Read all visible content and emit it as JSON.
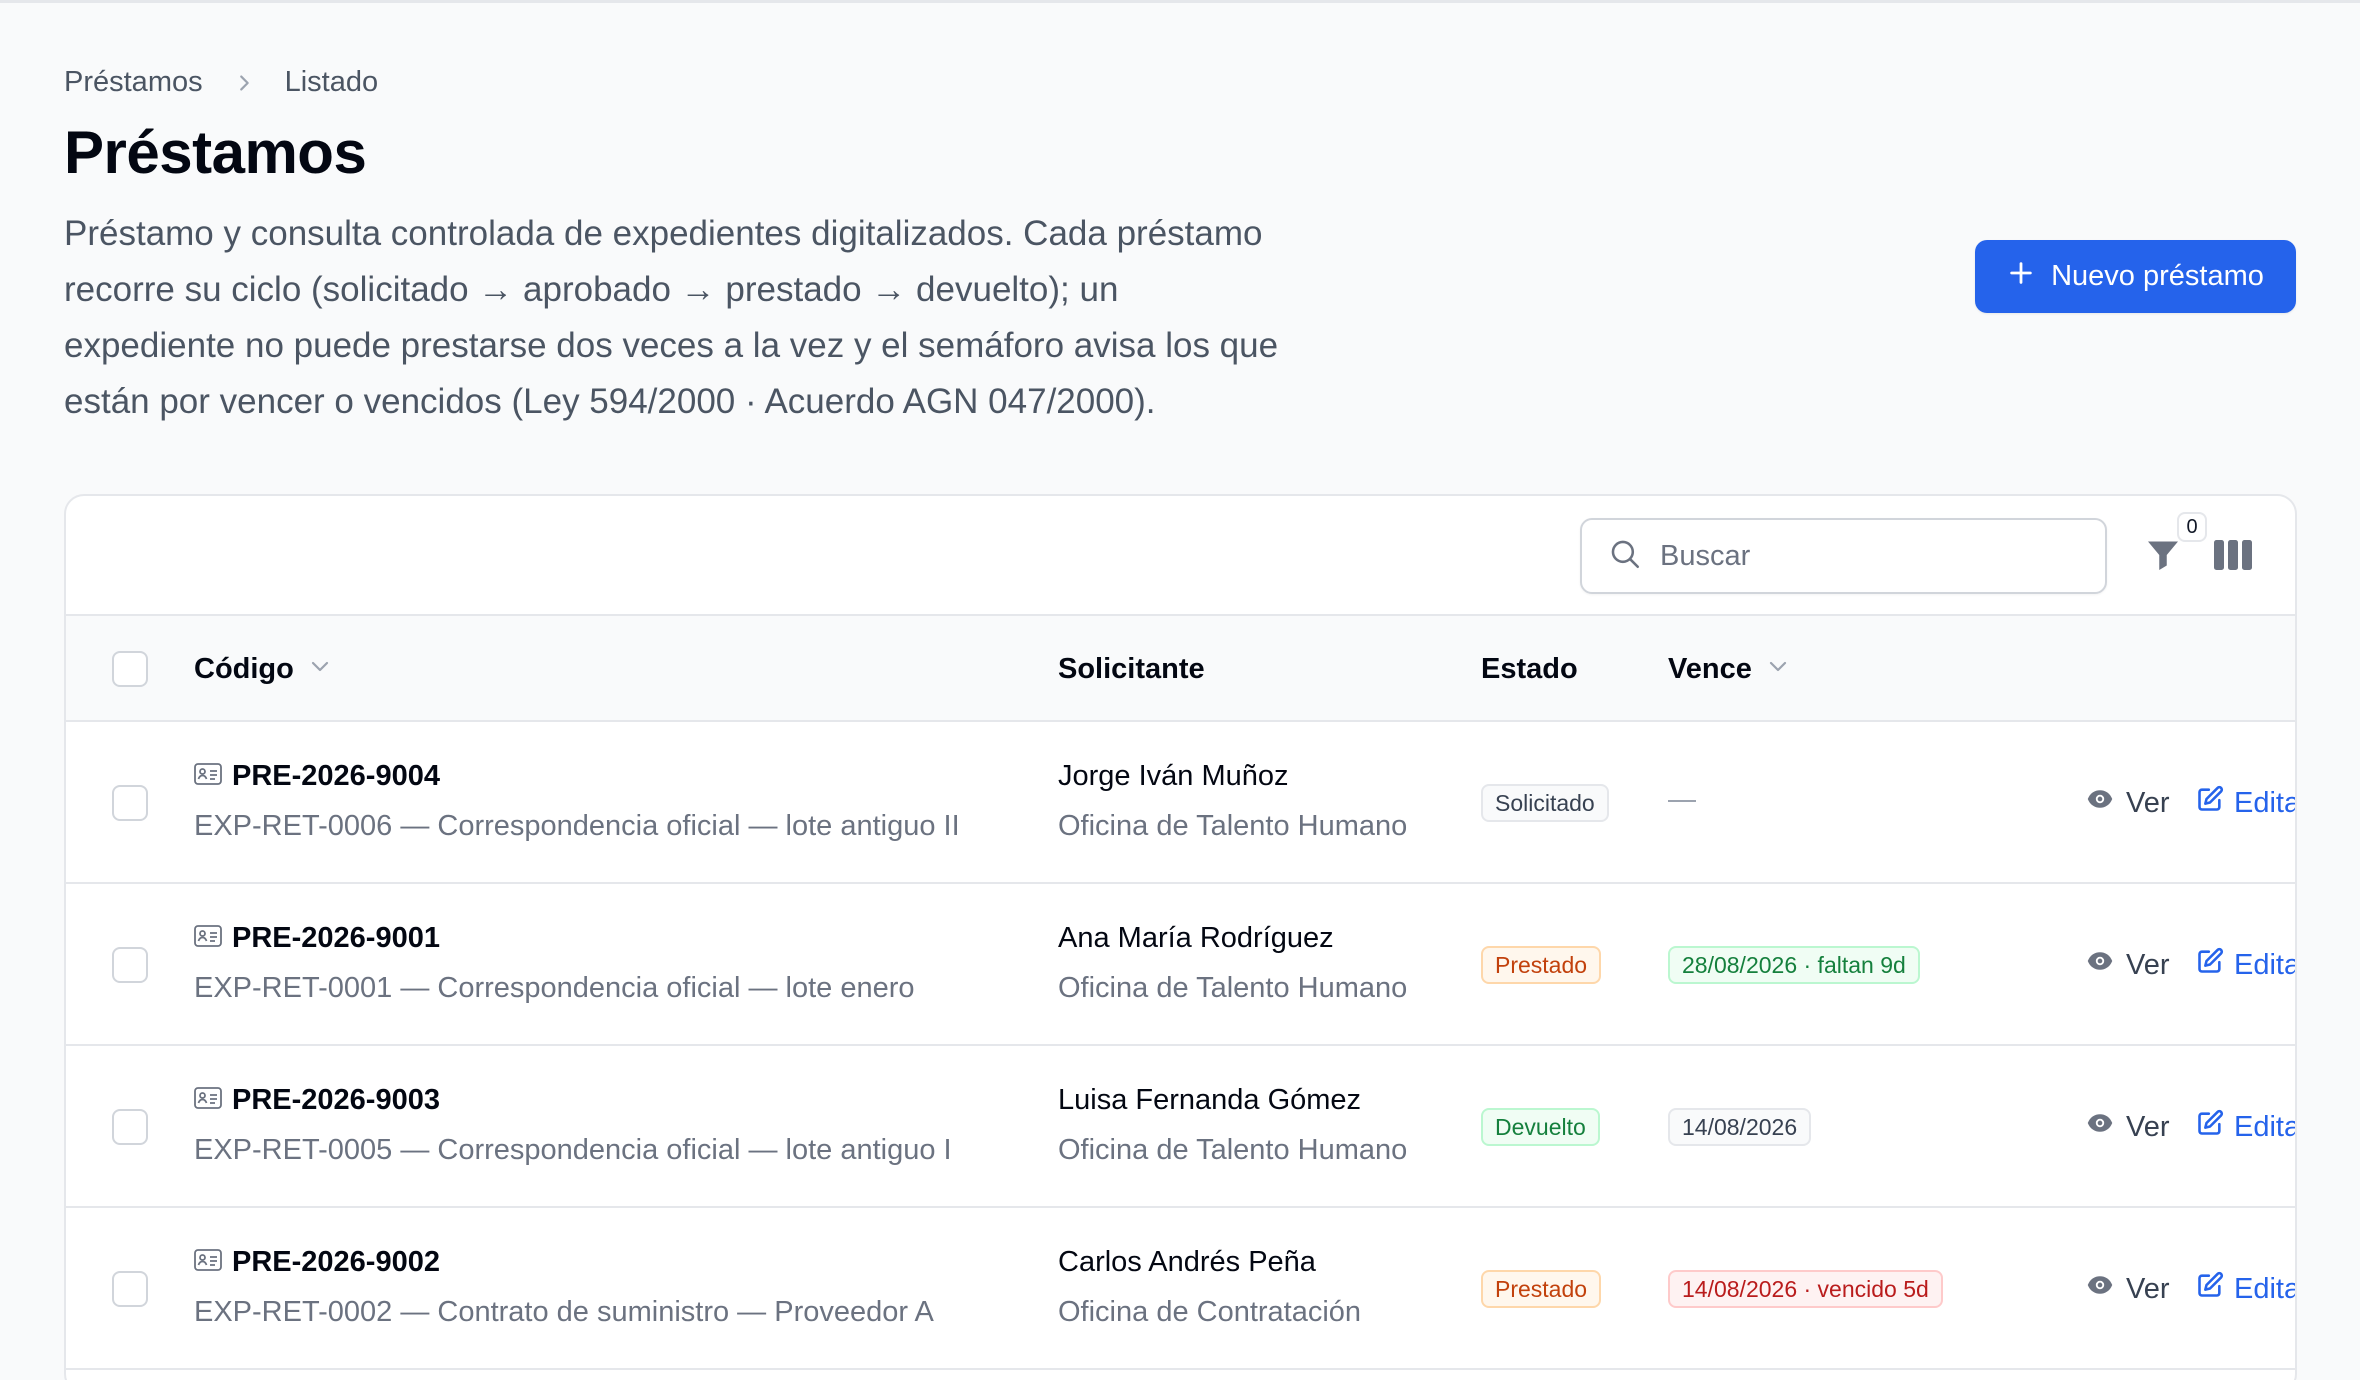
{
  "breadcrumb": {
    "items": [
      "Préstamos",
      "Listado"
    ]
  },
  "page": {
    "title": "Préstamos",
    "description_lines": [
      "Préstamo y consulta controlada de expedientes digitalizados. Cada préstamo",
      "recorre su ciclo (solicitado → aprobado → prestado → devuelto); un",
      "expediente no puede prestarse dos veces a la vez y el semáforo avisa los que",
      "están por vencer o vencidos (Ley 594/2000 · Acuerdo AGN 047/2000)."
    ]
  },
  "actions": {
    "new_button": "Nuevo préstamo"
  },
  "toolbar": {
    "search_placeholder": "Buscar",
    "filter_count": "0"
  },
  "table": {
    "columns": {
      "code": "Código",
      "requester": "Solicitante",
      "status": "Estado",
      "due": "Vence"
    },
    "view_label": "Ver",
    "edit_label": "Editar",
    "rows": [
      {
        "code": "PRE-2026-9004",
        "file": "EXP-RET-0006 — Correspondencia oficial — lote antiguo II",
        "requester": "Jorge Iván Muñoz",
        "office": "Oficina de Talento Humano",
        "status": "Solicitado",
        "due": ""
      },
      {
        "code": "PRE-2026-9001",
        "file": "EXP-RET-0001 — Correspondencia oficial — lote enero",
        "requester": "Ana María Rodríguez",
        "office": "Oficina de Talento Humano",
        "status": "Prestado",
        "due": "28/08/2026 · faltan 9d"
      },
      {
        "code": "PRE-2026-9003",
        "file": "EXP-RET-0005 — Correspondencia oficial — lote antiguo I",
        "requester": "Luisa Fernanda Gómez",
        "office": "Oficina de Talento Humano",
        "status": "Devuelto",
        "due": "14/08/2026"
      },
      {
        "code": "PRE-2026-9002",
        "file": "EXP-RET-0002 — Contrato de suministro — Proveedor A",
        "requester": "Carlos Andrés Peña",
        "office": "Oficina de Contratación",
        "status": "Prestado",
        "due": "14/08/2026 · vencido 5d"
      }
    ]
  },
  "colors": {
    "primary": "#2563eb",
    "status_requested": "#374151",
    "status_lent": "#c2410c",
    "status_returned": "#15803d",
    "due_ok": "#15803d",
    "due_overdue": "#b91c1c"
  }
}
